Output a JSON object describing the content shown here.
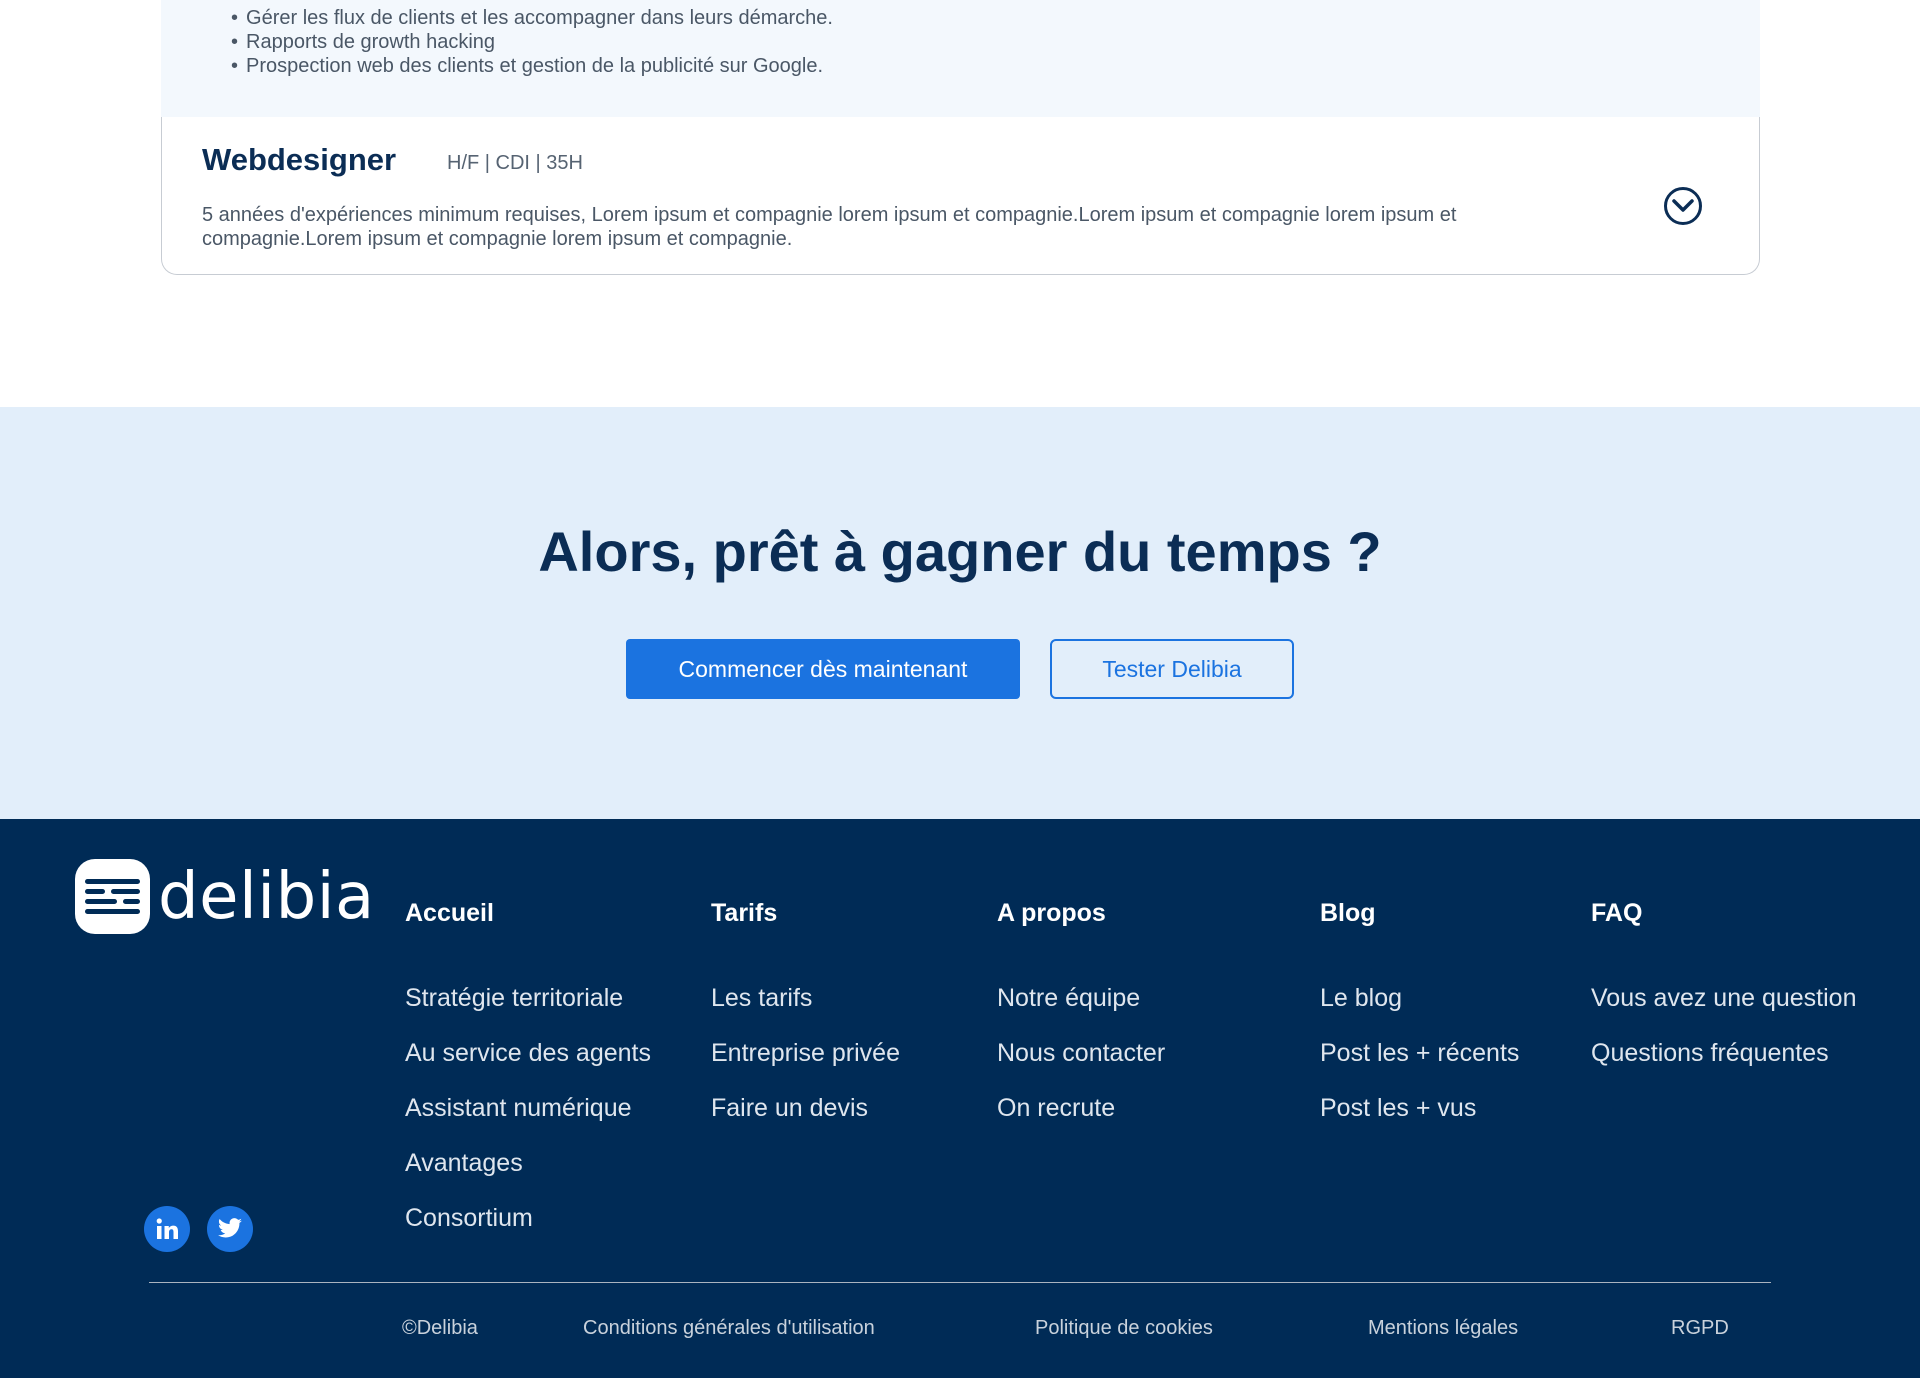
{
  "job_prev": {
    "bullets": [
      "Gérer les flux de clients et les accompagner dans leurs démarche.",
      "Rapports de growth hacking",
      "Prospection web des clients et gestion de la publicité sur Google."
    ]
  },
  "job": {
    "title": "Webdesigner",
    "meta": "H/F | CDI | 35H",
    "description": "5 années d'expériences minimum requises, Lorem ipsum et compagnie lorem ipsum et compagnie.Lorem ipsum et compagnie lorem ipsum et compagnie.Lorem ipsum et compagnie lorem ipsum et compagnie.",
    "toggle_icon": "chevron-down-icon"
  },
  "cta": {
    "title": "Alors, prêt à gagner du temps ?",
    "primary_label": "Commencer dès maintenant",
    "secondary_label": "Tester Delibia"
  },
  "footer": {
    "brand": "delibia",
    "columns": [
      {
        "title": "Accueil",
        "links": [
          "Stratégie territoriale",
          "Au service des agents",
          "Assistant numérique",
          "Avantages",
          "Consortium"
        ]
      },
      {
        "title": "Tarifs",
        "links": [
          "Les tarifs",
          "Entreprise privée",
          "Faire un devis"
        ]
      },
      {
        "title": "A propos",
        "links": [
          "Notre équipe",
          "Nous contacter",
          "On recrute"
        ]
      },
      {
        "title": "Blog",
        "links": [
          "Le blog",
          "Post les + récents",
          "Post les + vus"
        ]
      },
      {
        "title": "FAQ",
        "links": [
          "Vous avez une question",
          "Questions fréquentes"
        ]
      }
    ],
    "social": [
      "linkedin-icon",
      "twitter-icon"
    ],
    "legal": [
      "©Delibia",
      "Conditions générales d'utilisation",
      "Politique de cookies",
      "Mentions légales",
      "RGPD"
    ]
  },
  "colors": {
    "navy": "#002b56",
    "accent": "#1b73e0",
    "cta_bg": "#e2eefa",
    "heading": "#0b2d55"
  }
}
